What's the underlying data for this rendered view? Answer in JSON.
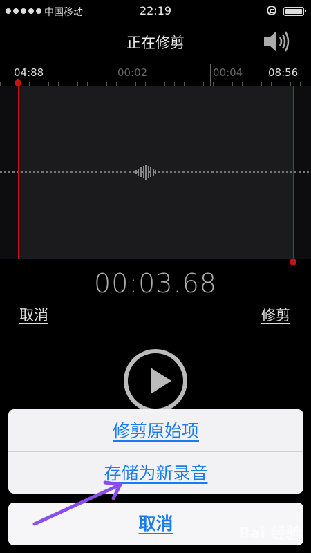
{
  "status_bar": {
    "carrier": "中国移动",
    "time": "22:19",
    "signal_icon": "signal-dots-icon",
    "lock_icon": "rotation-lock-icon",
    "battery_icon": "battery-icon"
  },
  "header": {
    "title": "正在修剪",
    "speaker_icon": "speaker-icon"
  },
  "timeline": {
    "start_label": "04:88",
    "marks": [
      "00:02",
      "00:04"
    ],
    "end_label": "08:56"
  },
  "playback": {
    "elapsed": "00:03.68"
  },
  "actions": {
    "cancel": "取消",
    "trim": "修剪"
  },
  "action_sheet": {
    "trim_original": "修剪原始项",
    "save_as_new": "存储为新录音",
    "cancel": "取消"
  },
  "watermark": "Bai 经验",
  "colors": {
    "accent_red": "#c8101a",
    "sheet_blue": "#1a7cf2",
    "annotation_purple": "#8a4df0"
  }
}
